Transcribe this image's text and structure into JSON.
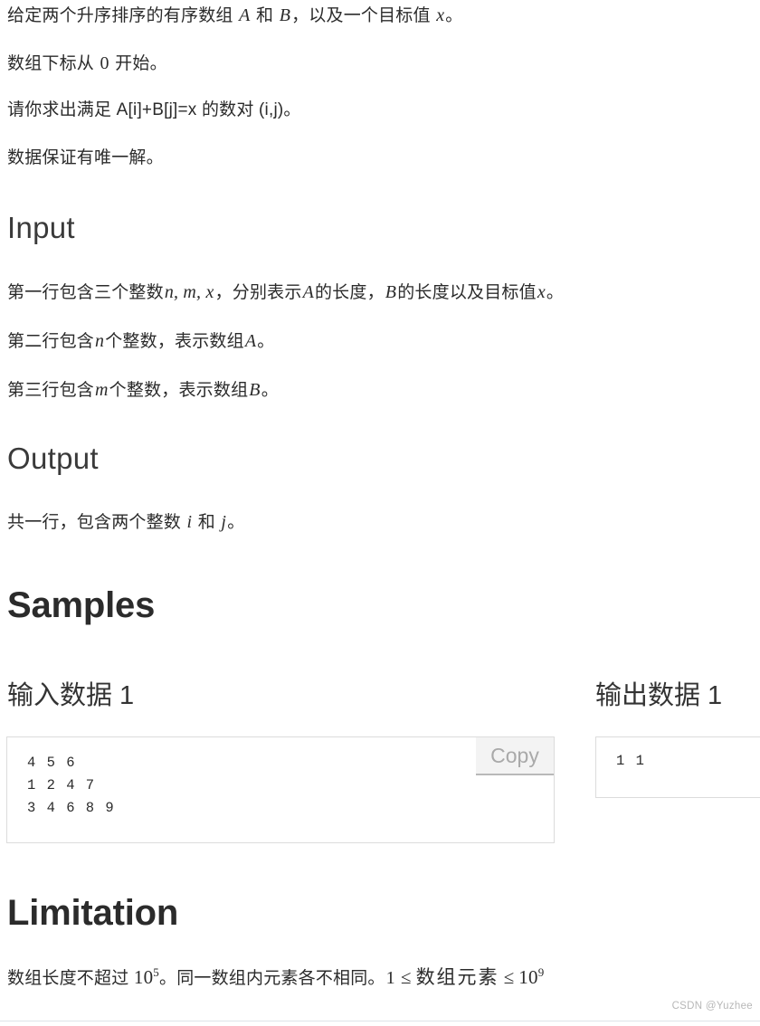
{
  "statement": {
    "line1_a": "给定两个升序排序的有序数组 ",
    "line1_var_a": "A",
    "line1_b": " 和 ",
    "line1_var_b": "B",
    "line1_c": "，以及一个目标值 ",
    "line1_var_x": "x",
    "line1_d": "。",
    "line2_a": "数组下标从 ",
    "line2_num": "0",
    "line2_b": " 开始。",
    "line3": "请你求出满足 A[i]+B[j]=x 的数对 (i,j)。",
    "line4": "数据保证有唯一解。"
  },
  "input_section": {
    "heading": "Input",
    "l1_a": "第一行包含三个整数",
    "l1_n": "n, m, x",
    "l1_b": "，分别表示",
    "l1_A": "A",
    "l1_c": "的长度，",
    "l1_B": "B",
    "l1_d": "的长度以及目标值",
    "l1_x": "x",
    "l1_e": "。",
    "l2_a": "第二行包含",
    "l2_n": "n",
    "l2_b": "个整数，表示数组",
    "l2_A": "A",
    "l2_c": "。",
    "l3_a": "第三行包含",
    "l3_m": "m",
    "l3_b": "个整数，表示数组",
    "l3_B": "B",
    "l3_c": "。"
  },
  "output_section": {
    "heading": "Output",
    "l1_a": "共一行，包含两个整数 ",
    "l1_i": "i",
    "l1_b": " 和 ",
    "l1_j": "j",
    "l1_c": "。"
  },
  "samples": {
    "heading": "Samples",
    "input_title": "输入数据 1",
    "output_title": "输出数据 1",
    "copy_label": "Copy",
    "input_code": "4 5 6\n1 2 4 7\n3 4 6 8 9",
    "output_code": "1 1"
  },
  "limitation": {
    "heading": "Limitation",
    "l1_a": "数组长度不超过 ",
    "l1_pow1_base": "10",
    "l1_pow1_exp": "5",
    "l1_b": "。同一数组内元素各不相同。",
    "l1_one": "1",
    "l1_le1": "≤",
    "l1_elem": "数组元素",
    "l1_le2": "≤",
    "l1_pow2_base": "10",
    "l1_pow2_exp": "9"
  },
  "watermark": "CSDN @Yuzhee",
  "colors": {
    "text": "#2b2b2b",
    "heading": "#3a3a3a",
    "code_border": "#dcdcdc",
    "copy_bg": "#f3f3f3",
    "copy_text": "#a9a9a9",
    "watermark": "#b7b7b7",
    "footer_rule": "#dde3e8"
  }
}
